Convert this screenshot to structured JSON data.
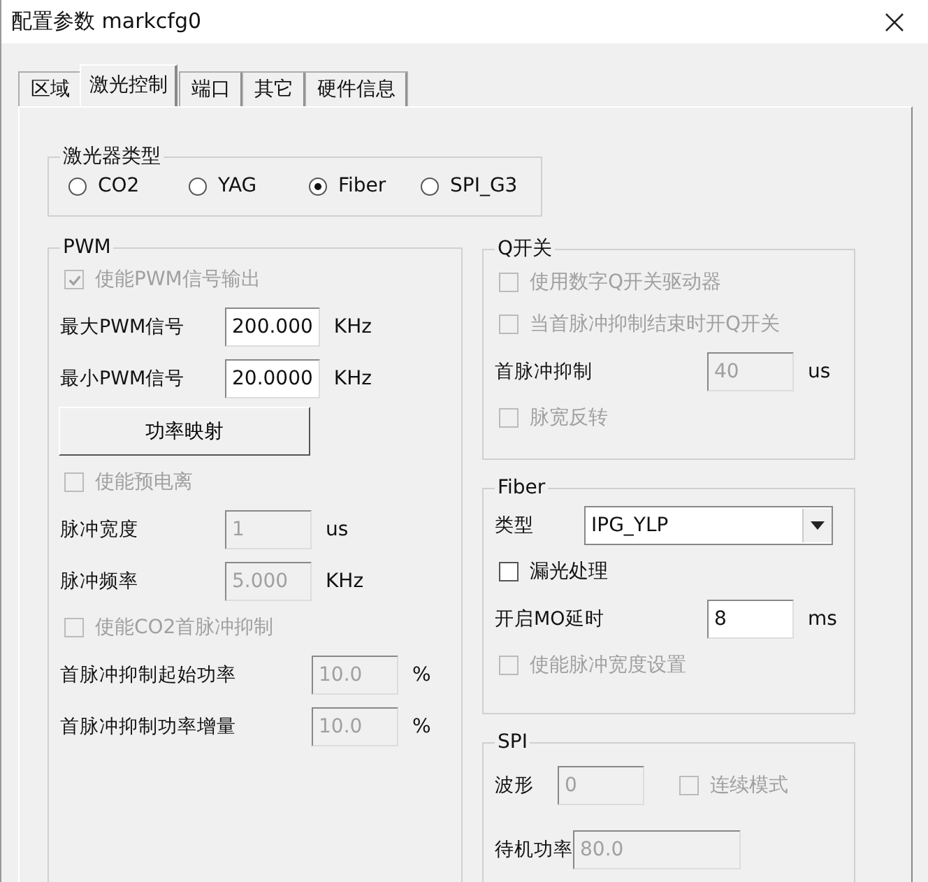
{
  "window": {
    "title": "配置参数 markcfg0"
  },
  "tabs": [
    {
      "label": "区域",
      "selected": false
    },
    {
      "label": "激光控制",
      "selected": true
    },
    {
      "label": "端口",
      "selected": false
    },
    {
      "label": "其它",
      "selected": false
    },
    {
      "label": "硬件信息",
      "selected": false
    }
  ],
  "laser_type": {
    "title": "激光器类型",
    "options": [
      {
        "label": "CO2",
        "selected": false
      },
      {
        "label": "YAG",
        "selected": false
      },
      {
        "label": "Fiber",
        "selected": true
      },
      {
        "label": "SPI_G3",
        "selected": false
      }
    ]
  },
  "pwm": {
    "title": "PWM",
    "rows": [
      {
        "kind": "checkbox",
        "label": "使能PWM信号输出",
        "checked": true,
        "disabled": true
      },
      {
        "kind": "field",
        "label": "最大PWM信号",
        "value": "200.000",
        "unit": "KHz",
        "disabled": false
      },
      {
        "kind": "field",
        "label": "最小PWM信号",
        "value": "20.0000",
        "unit": "KHz",
        "disabled": false
      },
      {
        "kind": "button",
        "label": "功率映射"
      },
      {
        "kind": "checkbox",
        "label": "使能预电离",
        "checked": false,
        "disabled": true
      },
      {
        "kind": "field",
        "label": "脉冲宽度",
        "value": "1",
        "unit": "us",
        "disabled": true
      },
      {
        "kind": "field",
        "label": "脉冲频率",
        "value": "5.000",
        "unit": "KHz",
        "disabled": true
      },
      {
        "kind": "checkbox",
        "label": "使能CO2首脉冲抑制",
        "checked": false,
        "disabled": true
      },
      {
        "kind": "field",
        "label": "首脉冲抑制起始功率",
        "value": "10.0",
        "unit": "%",
        "disabled": true
      },
      {
        "kind": "field",
        "label": "首脉冲抑制功率增量",
        "value": "10.0",
        "unit": "%",
        "disabled": true
      }
    ]
  },
  "q_switch": {
    "title": "Q开关",
    "rows": [
      {
        "kind": "checkbox",
        "label": "使用数字Q开关驱动器",
        "checked": false,
        "disabled": true
      },
      {
        "kind": "checkbox",
        "label": "当首脉冲抑制结束时开Q开关",
        "checked": false,
        "disabled": true
      },
      {
        "kind": "field",
        "label": "首脉冲抑制",
        "value": "40",
        "unit": "us",
        "disabled": true
      },
      {
        "kind": "checkbox",
        "label": "脉宽反转",
        "checked": false,
        "disabled": true
      }
    ]
  },
  "fiber": {
    "title": "Fiber",
    "rows": [
      {
        "kind": "select",
        "label": "类型",
        "value": "IPG_YLP"
      },
      {
        "kind": "checkbox",
        "label": "漏光处理",
        "checked": false,
        "disabled": false
      },
      {
        "kind": "field",
        "label": "开启MO延时",
        "value": "8",
        "unit": "ms",
        "disabled": false
      },
      {
        "kind": "checkbox",
        "label": "使能脉冲宽度设置",
        "checked": false,
        "disabled": true
      }
    ]
  },
  "spi": {
    "title": "SPI",
    "rows": [
      {
        "kind": "field",
        "label": "波形",
        "value": "0",
        "disabled": true,
        "checkbox": {
          "label": "连续模式",
          "checked": false,
          "disabled": true
        }
      },
      {
        "kind": "field",
        "label": "待机功率",
        "value": "80.0",
        "disabled": true
      }
    ]
  }
}
